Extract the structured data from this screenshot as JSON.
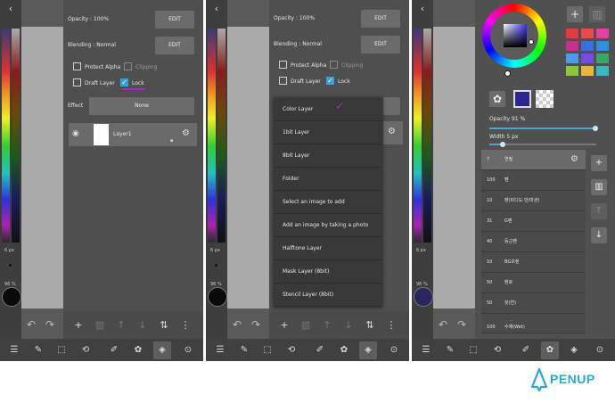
{
  "common": {
    "back": "‹",
    "size_label": "6 px",
    "opacity_small": "96 %",
    "colors": {
      "accent": "#3a9ed8",
      "check": "#b31fd6",
      "logo": "#2aa7d9"
    },
    "toolbar_icons": [
      "menu-icon",
      "edit-icon",
      "select-icon",
      "transform-icon",
      "brush-icon",
      "palette-icon",
      "layers-icon",
      "more-icon"
    ]
  },
  "panel1": {
    "opacity_label": "Opacity : 100%",
    "edit1": "EDIT",
    "blending_label": "Blending : Normal",
    "edit2": "EDIT",
    "protect_alpha": "Protect Alpha",
    "clipping": "Clipping",
    "draft_layer": "Draft Layer",
    "lock": "Lock",
    "effect_label": "Effect",
    "effect_value": "None",
    "layer_name": "Layer1"
  },
  "panel2": {
    "opacity_label": "Opacity : 100%",
    "edit1": "EDIT",
    "blending_label": "Blending : Normal",
    "edit2": "EDIT",
    "protect_alpha": "Protect Alpha",
    "clipping": "Clipping",
    "draft_layer": "Draft Layer",
    "lock": "Lock",
    "menu": [
      "Color Layer",
      "1bit Layer",
      "8bit Layer",
      "Folder",
      "Select an image to add",
      "Add an image by taking a photo",
      "Halftone Layer",
      "Mask Layer (8bit)",
      "Stencil Layer (8bit)"
    ]
  },
  "panel3": {
    "opacity_label": "Opacity 91 %",
    "opacity_value": 91,
    "width_label": "Width 5 px",
    "width_value": 5,
    "palette": [
      "#e23a3a",
      "#e8484e",
      "#e23ea4",
      "#c9308a",
      "#3a6fe0",
      "#2f8ee0",
      "#4a9be8",
      "#7a4ae0",
      "#3aa860",
      "#8ac83a",
      "#e8b83a",
      "#3ab8c0"
    ],
    "brushes": [
      {
        "n": "7",
        "t": "연필"
      },
      {
        "n": "100",
        "t": "펜"
      },
      {
        "n": "10",
        "t": "펜(피디도 만/마관)"
      },
      {
        "n": "31",
        "t": "G펜"
      },
      {
        "n": "40",
        "t": "둥근펜"
      },
      {
        "n": "10",
        "t": "BG프렌"
      },
      {
        "n": "50",
        "t": "펜로"
      },
      {
        "n": "50",
        "t": "붓(연)"
      },
      {
        "n": "49",
        "t": "수채"
      },
      {
        "n": "100",
        "t": "수채(Wet)"
      }
    ]
  },
  "logo": {
    "word": "PENUP"
  }
}
